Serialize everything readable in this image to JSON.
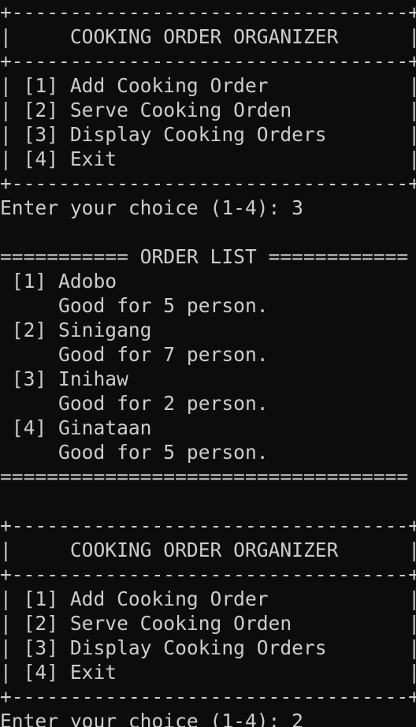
{
  "terminal": {
    "lines": [
      "+----------------------------------+",
      "|     COOKING ORDER ORGANIZER      |",
      "+----------------------------------+",
      "| [1] Add Cooking Order            |",
      "| [2] Serve Cooking Orden          |",
      "| [3] Display Cooking Orders       |",
      "| [4] Exit                         |",
      "+----------------------------------+",
      "Enter your choice (1-4): 3",
      "",
      "=========== ORDER LIST ============",
      " [1] Adobo",
      "     Good for 5 person.",
      " [2] Sinigang",
      "     Good for 7 person.",
      " [3] Inihaw",
      "     Good for 2 person.",
      " [4] Ginataan",
      "     Good for 5 person.",
      "===================================",
      "",
      "+----------------------------------+",
      "|     COOKING ORDER ORGANIZER      |",
      "+----------------------------------+",
      "| [1] Add Cooking Order            |",
      "| [2] Serve Cooking Orden          |",
      "| [3] Display Cooking Orders       |",
      "| [4] Exit                         |",
      "+----------------------------------+",
      "Enter your choice (1-4): 2"
    ]
  }
}
